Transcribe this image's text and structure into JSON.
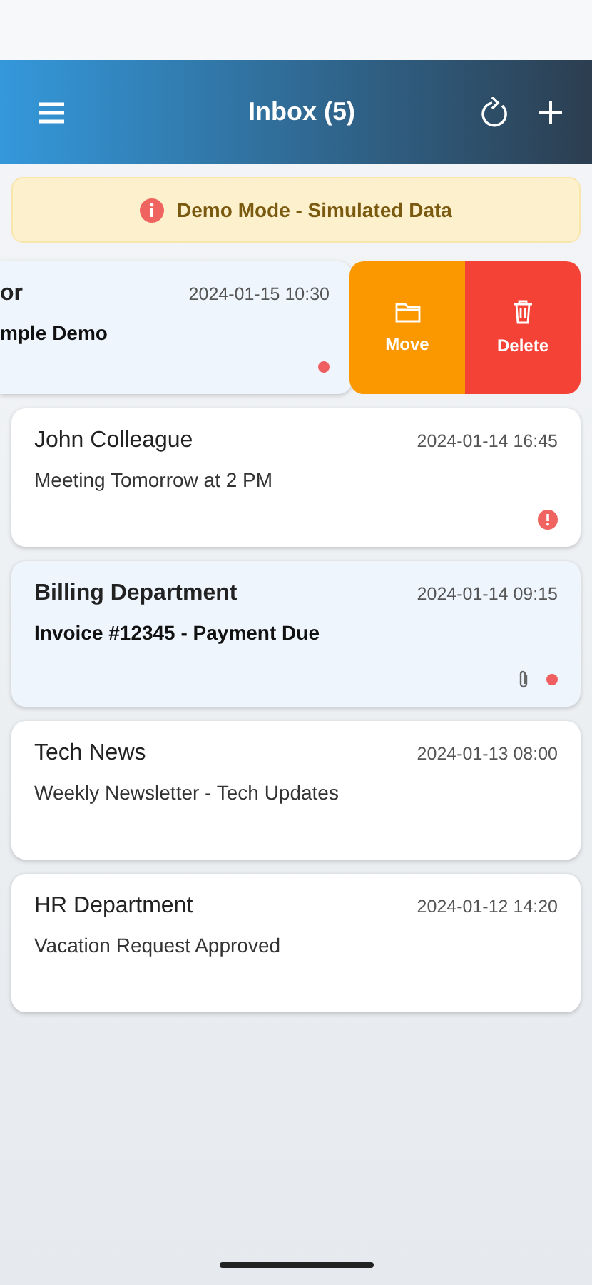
{
  "header": {
    "title": "Inbox (5)"
  },
  "banner": {
    "text": "Demo Mode - Simulated Data"
  },
  "swipe_actions": [
    {
      "kind": "move",
      "label": "Move"
    },
    {
      "kind": "delete",
      "label": "Delete"
    }
  ],
  "emails": [
    {
      "sender": "or",
      "subject": "mple Demo",
      "date": "2024-01-15 10:30",
      "unread": true,
      "important": false,
      "attachment": false,
      "swiped": true
    },
    {
      "sender": "John Colleague",
      "subject": "Meeting Tomorrow at 2 PM",
      "date": "2024-01-14 16:45",
      "unread": false,
      "important": true,
      "attachment": false,
      "swiped": false
    },
    {
      "sender": "Billing Department",
      "subject": "Invoice #12345 - Payment Due",
      "date": "2024-01-14 09:15",
      "unread": true,
      "important": false,
      "attachment": true,
      "swiped": false
    },
    {
      "sender": "Tech News",
      "subject": "Weekly Newsletter - Tech Updates",
      "date": "2024-01-13 08:00",
      "unread": false,
      "important": false,
      "attachment": false,
      "swiped": false
    },
    {
      "sender": "HR Department",
      "subject": "Vacation Request Approved",
      "date": "2024-01-12 14:20",
      "unread": false,
      "important": false,
      "attachment": false,
      "swiped": false
    }
  ]
}
